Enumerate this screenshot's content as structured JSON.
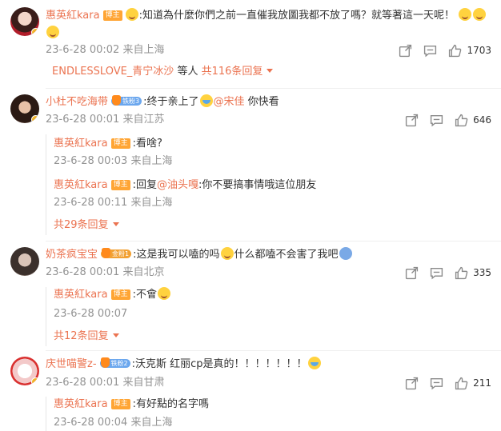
{
  "comments": [
    {
      "name": "惠英紅kara",
      "badge": "博主",
      "text": ":知道為什麼你們之前一直催我放圖我都不放了嗎？就等著這一天呢！",
      "time": "23-6-28 00:02 来自上海",
      "likes": "1703",
      "preview_name": "ENDLESSLOVE_青宁冰沙",
      "preview_suffix": "等人",
      "preview_count": "共116条回复"
    },
    {
      "name": "小杜不吃海带",
      "fan_level": "铁粉3",
      "text_a": ":终于亲上了",
      "mention": "@宋佳",
      "text_b": " 你快看",
      "time": "23-6-28 00:01 来自江苏",
      "likes": "646",
      "replies": [
        {
          "name": "惠英紅kara",
          "badge": "博主",
          "text": ":看啥?",
          "time": "23-6-28 00:03 来自上海"
        },
        {
          "name": "惠英紅kara",
          "badge": "博主",
          "text_a": ":回复",
          "mention": "@油头嘎",
          "text_b": ":你不要搞事情哦這位朋友",
          "time": "23-6-28 00:11 来自上海"
        }
      ],
      "more": "共29条回复"
    },
    {
      "name": "奶茶疯宝宝",
      "fan_level": "金粉1",
      "text_a": ":这是我可以嗑的吗",
      "text_b": "什么都嗑不会害了我吧",
      "time": "23-6-28 00:01 来自北京",
      "likes": "335",
      "replies": [
        {
          "name": "惠英紅kara",
          "badge": "博主",
          "text": ":不會",
          "time": "23-6-28 00:07"
        }
      ],
      "more": "共12条回复"
    },
    {
      "name": "庆世喵警z-",
      "fan_level": "铁粉2",
      "text": ":沃克斯 红丽cp是真的！！！！！！！",
      "time": "23-6-28 00:01 来自甘肃",
      "likes": "211",
      "replies": [
        {
          "name": "惠英紅kara",
          "badge": "博主",
          "text": ":有好點的名字嗎",
          "time": "23-6-28 00:04 来自上海"
        }
      ]
    }
  ],
  "icons": {
    "share": "share-icon",
    "comment": "comment-icon",
    "like": "thumbs-up-icon"
  },
  "colors": {
    "name": "#eb7350",
    "meta": "#939393",
    "badge": "#ffa534"
  }
}
